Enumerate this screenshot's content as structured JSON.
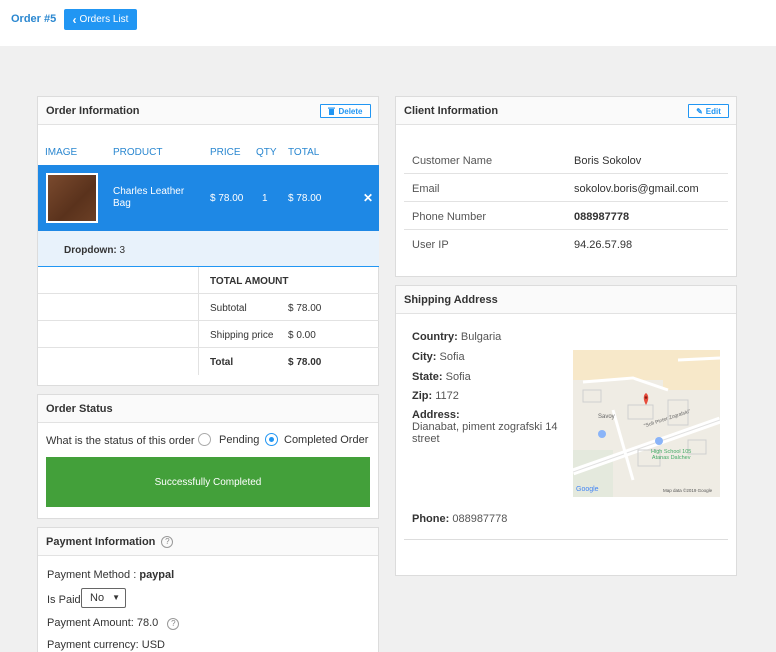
{
  "header": {
    "order_title": "Order #5",
    "orders_list_label": "Orders List"
  },
  "order_info": {
    "title": "Order Information",
    "delete_label": "Delete",
    "columns": [
      "IMAGE",
      "PRODUCT",
      "PRICE",
      "QTY",
      "TOTAL"
    ],
    "product": {
      "name_line1": "Charles Leather",
      "name_line2": "Bag",
      "price": "$ 78.00",
      "qty": "1",
      "total": "$ 78.00"
    },
    "remove_symbol": "✕",
    "dropdown_label": "Dropdown:",
    "dropdown_value": "3",
    "total_amount_label": "TOTAL AMOUNT",
    "subtotal_label": "Subtotal",
    "subtotal_value": "$ 78.00",
    "shipping_label": "Shipping price",
    "shipping_value": "$ 0.00",
    "total_label": "Total",
    "total_value": "$ 78.00"
  },
  "order_status": {
    "title": "Order Status",
    "question": "What is the status of this order",
    "option_pending": "Pending",
    "option_completed": "Completed Order",
    "success_message": "Successfully Completed"
  },
  "payment": {
    "title": "Payment Information",
    "method_label": "Payment Method :",
    "method_value": "paypal",
    "paid_label": "Is Paid:",
    "paid_value": "No",
    "amount_label": "Payment Amount: 78.0",
    "currency_label": "Payment currency: USD"
  },
  "client": {
    "title": "Client Information",
    "edit_label": "Edit",
    "rows": [
      {
        "key": "Customer Name",
        "value": "Boris Sokolov"
      },
      {
        "key": "Email",
        "value": "sokolov.boris@gmail.com"
      },
      {
        "key": "Phone Number",
        "value": "088987778"
      },
      {
        "key": "User IP",
        "value": "94.26.57.98"
      }
    ]
  },
  "shipping": {
    "title": "Shipping Address",
    "country_label": "Country:",
    "country_value": "Bulgaria",
    "city_label": "City:",
    "city_value": "Sofia",
    "state_label": "State:",
    "state_value": "Sofia",
    "zip_label": "Zip:",
    "zip_value": "1172",
    "address_label": "Address:",
    "address_line1": "Dianabat, piment zografski 14",
    "address_line2": "street",
    "phone_label": "Phone:",
    "phone_value": "088987778",
    "map": {
      "street_label": "\"Sofi Pinter Zografski\"",
      "poi_savoy": "Savoy",
      "poi_school_1": "High School 105",
      "poi_school_2": "Atanas Dalchev",
      "google": "Google",
      "map_data": "Map data ©2019 Google"
    }
  }
}
